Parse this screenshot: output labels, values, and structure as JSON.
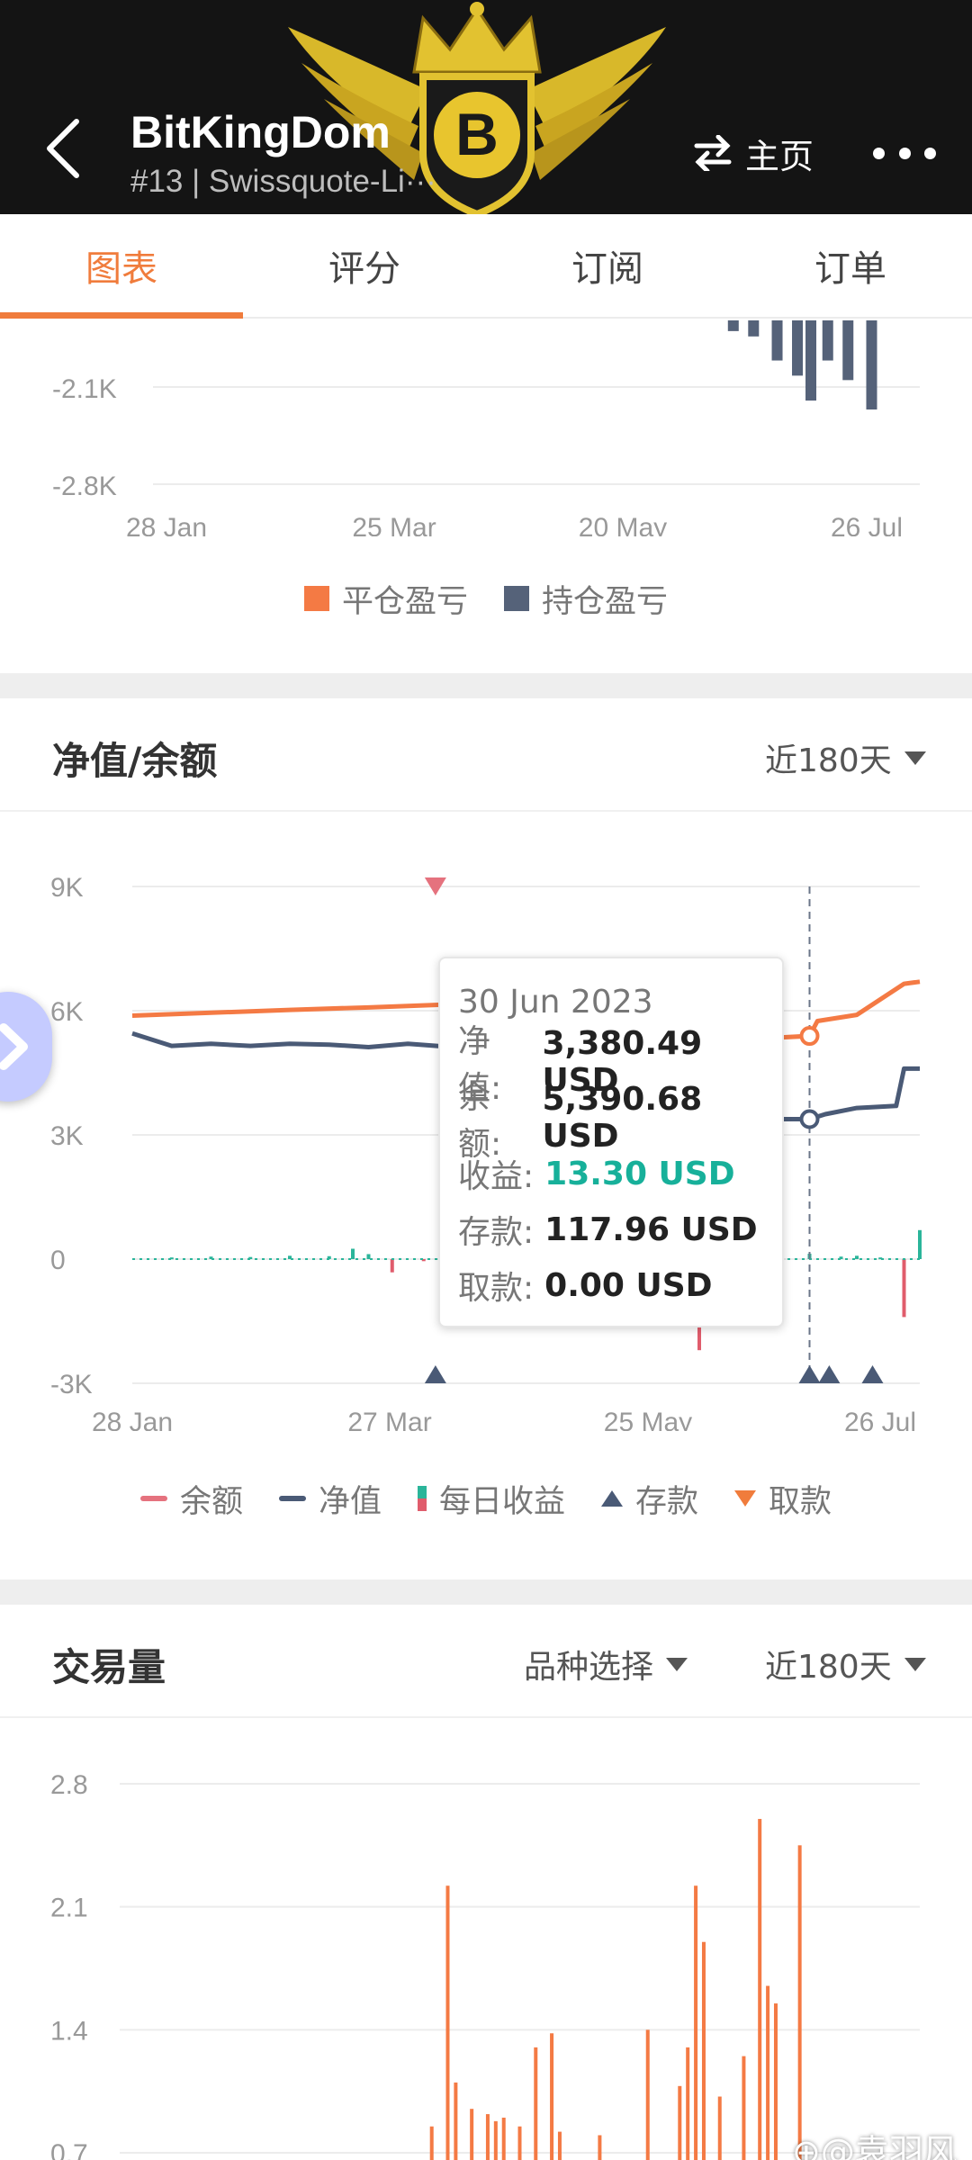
{
  "header": {
    "title": "BitKingDom",
    "subtitle": "#13 | Swissquote-Li···",
    "home_label": "主页"
  },
  "tabs": [
    {
      "label": "图表",
      "active": true
    },
    {
      "label": "评分",
      "active": false
    },
    {
      "label": "订阅",
      "active": false
    },
    {
      "label": "订单",
      "active": false
    }
  ],
  "pnl_section": {
    "y_ticks": [
      "-2.1K",
      "-2.8K"
    ],
    "x_ticks": [
      "28 Jan",
      "25 Mar",
      "20 May",
      "26 Jul"
    ],
    "legend": [
      {
        "label": "平仓盈亏",
        "color": "#f47a44"
      },
      {
        "label": "持仓盈亏",
        "color": "#556279"
      }
    ]
  },
  "equity_section": {
    "title": "净值/余额",
    "range_label": "近180天",
    "legend": {
      "balance": "余额",
      "equity": "净值",
      "daily": "每日收益",
      "deposit": "存款",
      "withdraw": "取款"
    },
    "tooltip": {
      "date": "30 Jun 2023",
      "equity_label": "净值:",
      "equity_value": "3,380.49 USD",
      "balance_label": "余额:",
      "balance_value": "5,390.68 USD",
      "profit_label": "收益:",
      "profit_value": "13.30 USD",
      "deposit_label": "存款:",
      "deposit_value": "117.96 USD",
      "withdraw_label": "取款:",
      "withdraw_value": "0.00 USD"
    }
  },
  "volume_section": {
    "title": "交易量",
    "symbol_label": "品种选择",
    "range_label": "近180天"
  },
  "colors": {
    "accent": "#f07c3c",
    "balance": "#f47a44",
    "equity": "#4a5a76",
    "profit_positive": "#2bb59a",
    "profit_negative": "#e05c6c"
  },
  "watermark": "⊕@袁羽风",
  "chart_data": [
    {
      "type": "bar",
      "title": "",
      "x_ticks": [
        "28 Jan",
        "25 Mar",
        "20 May",
        "26 Jul"
      ],
      "ylim": [
        -2800,
        0
      ],
      "y_ticks": [
        -2100,
        -2800
      ],
      "series": [
        {
          "name": "持仓盈亏",
          "x": [
            0.86,
            0.89,
            0.925,
            0.955,
            0.975,
            1.0,
            1.03,
            1.065
          ],
          "values": [
            -120,
            -180,
            -450,
            -620,
            -900,
            -450,
            -670,
            -1000
          ]
        }
      ]
    },
    {
      "type": "line",
      "title": "",
      "x_ticks": [
        "28 Jan",
        "27 Mar",
        "25 May",
        "26 Jul"
      ],
      "ylim": [
        -3000,
        9000
      ],
      "y_ticks": [
        9000,
        6000,
        3000,
        0,
        -3000
      ],
      "series": [
        {
          "name": "余额",
          "x": [
            0,
            0.1,
            0.2,
            0.3,
            0.4,
            0.47,
            0.82,
            0.86,
            0.87,
            0.92,
            0.98,
            1.0
          ],
          "values": [
            5880,
            5950,
            6020,
            6080,
            6150,
            6200,
            5350,
            5390,
            5750,
            5900,
            6650,
            6700
          ]
        },
        {
          "name": "净值",
          "x": [
            0,
            0.05,
            0.1,
            0.15,
            0.2,
            0.25,
            0.3,
            0.35,
            0.4,
            0.45,
            0.47,
            0.82,
            0.86,
            0.88,
            0.92,
            0.97,
            0.98,
            1.0
          ],
          "values": [
            5450,
            5150,
            5200,
            5150,
            5200,
            5180,
            5120,
            5200,
            5130,
            5020,
            4900,
            3380,
            3380,
            3500,
            3650,
            3700,
            4600,
            4600
          ]
        },
        {
          "name": "每日收益",
          "x": [
            0.05,
            0.1,
            0.15,
            0.2,
            0.25,
            0.28,
            0.3,
            0.33,
            0.37,
            0.4,
            0.42,
            0.45,
            0.6,
            0.72,
            0.86,
            0.9,
            0.92,
            0.95,
            0.98,
            1.0
          ],
          "values": [
            40,
            60,
            50,
            80,
            70,
            250,
            120,
            -320,
            -50,
            100,
            80,
            60,
            -1500,
            -2200,
            130,
            60,
            80,
            40,
            -1400,
            700
          ]
        }
      ],
      "deposits_x": [
        "25 May",
        "30 Jun",
        "5 Jul",
        "20 Jul"
      ],
      "withdraw_x": [
        "20 May"
      ]
    },
    {
      "type": "bar",
      "title": "",
      "ylim": [
        0.7,
        2.8
      ],
      "y_ticks": [
        2.8,
        2.1,
        1.4,
        0.7
      ],
      "series": [
        {
          "name": "",
          "x": [
            0.39,
            0.41,
            0.42,
            0.44,
            0.46,
            0.47,
            0.48,
            0.5,
            0.52,
            0.54,
            0.55,
            0.6,
            0.66,
            0.7,
            0.71,
            0.72,
            0.73,
            0.75,
            0.78,
            0.8,
            0.81,
            0.82,
            0.85
          ],
          "values": [
            0.85,
            2.22,
            1.1,
            0.95,
            0.92,
            0.88,
            0.9,
            0.85,
            1.3,
            1.38,
            0.82,
            0.8,
            1.4,
            1.08,
            1.3,
            2.22,
            1.9,
            1.02,
            1.25,
            2.6,
            1.65,
            1.55,
            2.45
          ]
        }
      ]
    }
  ]
}
